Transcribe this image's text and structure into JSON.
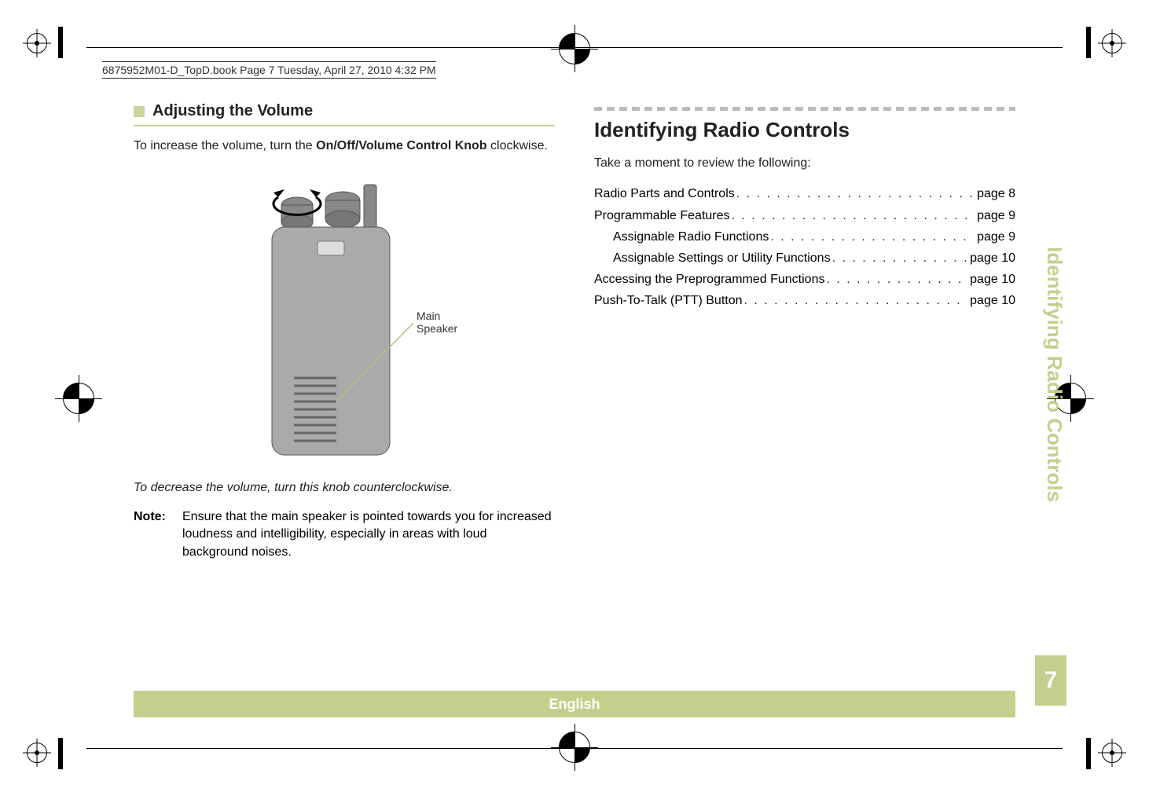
{
  "print_header": "6875952M01-D_TopD.book  Page 7  Tuesday, April 27, 2010  4:32 PM",
  "left": {
    "section_title": "Adjusting the Volume",
    "intro_prefix": "To increase the volume, turn the ",
    "intro_bold": "On/Off/Volume Control Knob",
    "intro_suffix": " clockwise.",
    "figure_label_line1": "Main",
    "figure_label_line2": "Speaker",
    "decrease_text": "To decrease the volume, turn this knob counterclockwise.",
    "note_label": "Note:",
    "note_text": "Ensure that the main speaker is pointed towards you for increased loudness and intelligibility, especially in areas with loud background noises."
  },
  "right": {
    "main_heading": "Identifying Radio Controls",
    "intro": "Take a moment to review the following:",
    "toc": [
      {
        "label": "Radio Parts and Controls",
        "page": "page 8",
        "indent": false
      },
      {
        "label": "Programmable Features",
        "page": "page 9",
        "indent": false
      },
      {
        "label": "Assignable Radio Functions",
        "page": "page 9",
        "indent": true
      },
      {
        "label": "Assignable Settings or Utility Functions",
        "page": "page 10",
        "indent": true
      },
      {
        "label": "Accessing the Preprogrammed Functions",
        "page": "page 10",
        "indent": false
      },
      {
        "label": "Push-To-Talk (PTT) Button",
        "page": "page 10",
        "indent": false
      }
    ]
  },
  "side_tab": {
    "label": "Identifying Radio Controls",
    "page_number": "7"
  },
  "language": "English"
}
